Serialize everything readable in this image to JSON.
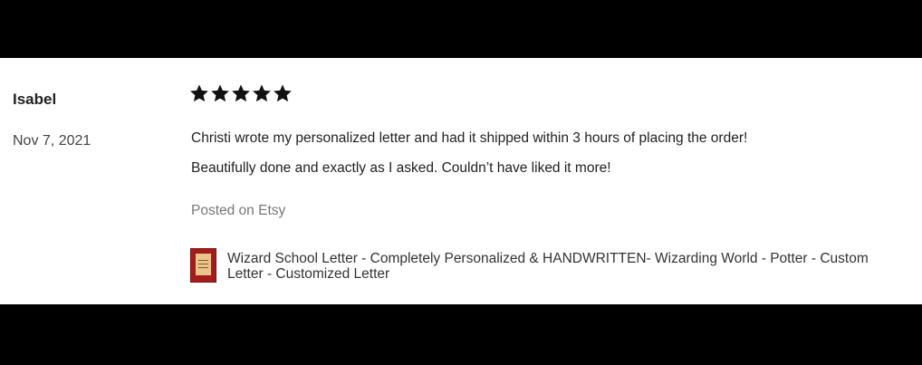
{
  "review": {
    "reviewer_name": "Isabel",
    "date": "Nov 7, 2021",
    "rating": 5,
    "rating_max": 5,
    "text_line_1": "Christi wrote my personalized letter and had it shipped within 3 hours of placing the order!",
    "text_line_2": "Beautifully done and exactly as I asked. Couldn’t have liked it more!",
    "posted_on": "Posted on Etsy",
    "item_title": "Wizard School Letter - Completely Personalized & HANDWRITTEN- Wizarding World - Potter - Custom Letter - Customized Letter"
  },
  "icons": {
    "star": "star-icon",
    "thumbnail": "letter-thumbnail"
  },
  "colors": {
    "card_background": "#ffffff",
    "frame_background": "#000000",
    "star_color": "#111111",
    "muted_text": "#777777",
    "thumbnail_red": "#a51c1c"
  }
}
